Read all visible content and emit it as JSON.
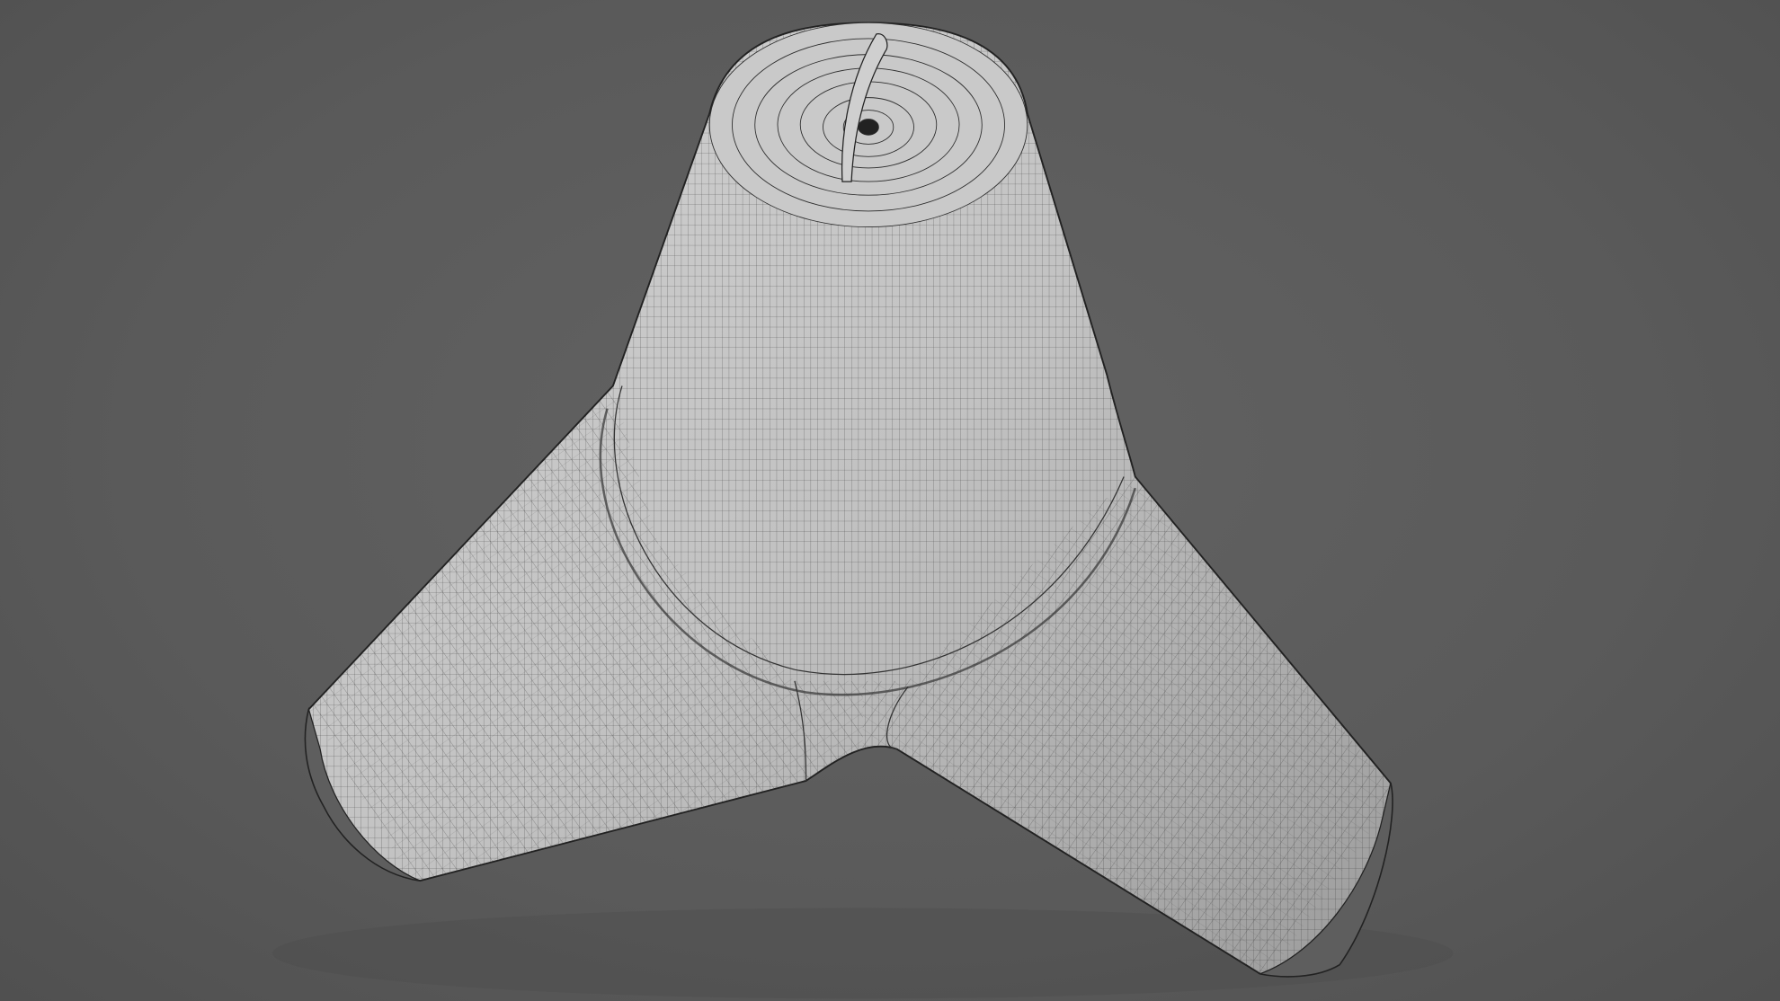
{
  "scene": {
    "subject": "tetrapod-wireframe-render",
    "background_color": "#5a5a5a",
    "mesh_fill_color": "#c4c4c4",
    "wire_color": "#2e2e2e"
  }
}
